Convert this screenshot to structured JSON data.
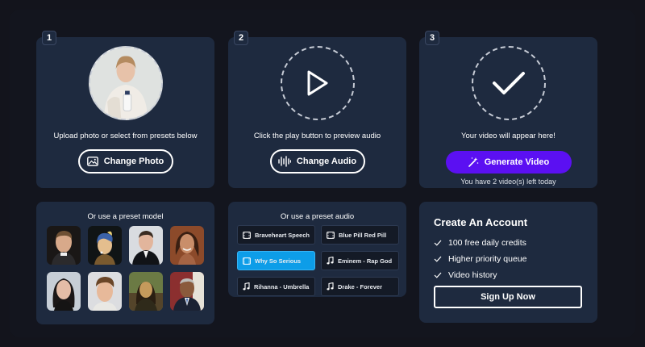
{
  "steps": {
    "photo": {
      "number": "1",
      "caption": "Upload photo or select from presets below",
      "button": "Change Photo",
      "icon": "image-icon"
    },
    "audio": {
      "number": "2",
      "caption": "Click the play button to preview audio",
      "button": "Change Audio",
      "icon": "audio-wave-icon"
    },
    "video": {
      "number": "3",
      "caption": "Your video will appear here!",
      "button": "Generate Video",
      "remaining": "You have 2 video(s) left today",
      "icon": "magic-wand-icon"
    }
  },
  "presets": {
    "title": "Or use a preset model",
    "models": [
      {
        "name": "preset-model-1"
      },
      {
        "name": "preset-model-2"
      },
      {
        "name": "preset-model-3"
      },
      {
        "name": "preset-model-4"
      },
      {
        "name": "preset-model-5"
      },
      {
        "name": "preset-model-6"
      },
      {
        "name": "preset-model-7"
      },
      {
        "name": "preset-model-8"
      }
    ]
  },
  "audio_presets": {
    "title": "Or use a preset audio",
    "items": [
      {
        "label": "Braveheart Speech",
        "icon": "film-icon",
        "selected": false
      },
      {
        "label": "Blue Pill Red Pill",
        "icon": "film-icon",
        "selected": false
      },
      {
        "label": "Why So Serious",
        "icon": "film-icon",
        "selected": true
      },
      {
        "label": "Eminem - Rap God",
        "icon": "music-note-icon",
        "selected": false
      },
      {
        "label": "Rihanna - Umbrella",
        "icon": "music-note-icon",
        "selected": false
      },
      {
        "label": "Drake - Forever",
        "icon": "music-note-icon",
        "selected": false
      }
    ]
  },
  "account": {
    "title": "Create An Account",
    "features": [
      "100 free daily credits",
      "Higher priority queue",
      "Video history"
    ],
    "cta": "Sign Up Now"
  },
  "colors": {
    "card": "#1e2a3f",
    "accent": "#5b10f2",
    "selected_audio": "#0d9de8"
  }
}
